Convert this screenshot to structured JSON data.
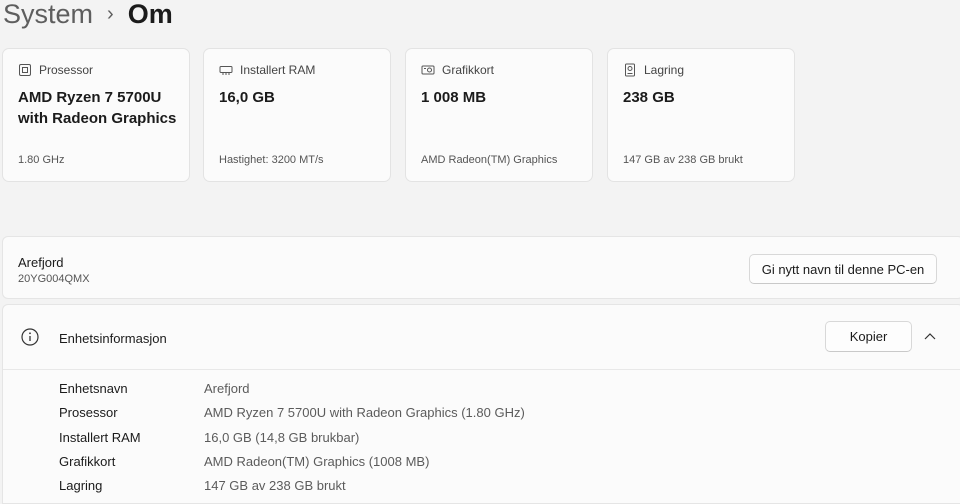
{
  "breadcrumb": {
    "parent": "System",
    "separator": "›",
    "current": "Om"
  },
  "cards": [
    {
      "icon": "processor-icon",
      "label": "Prosessor",
      "value": "AMD Ryzen 7 5700U with Radeon Graphics",
      "sub": "1.80 GHz"
    },
    {
      "icon": "memory-icon",
      "label": "Installert RAM",
      "value": "16,0 GB",
      "sub": "Hastighet: 3200 MT/s"
    },
    {
      "icon": "graphics-card-icon",
      "label": "Grafikkort",
      "value": "1 008 MB",
      "sub": "AMD Radeon(TM) Graphics"
    },
    {
      "icon": "storage-icon",
      "label": "Lagring",
      "value": "238 GB",
      "sub": "147 GB av 238 GB brukt"
    }
  ],
  "device": {
    "name": "Arefjord",
    "model": "20YG004QMX",
    "rename_label": "Gi nytt navn til denne PC-en"
  },
  "info": {
    "title": "Enhetsinformasjon",
    "copy_label": "Kopier",
    "rows": [
      {
        "label": "Enhetsnavn",
        "value": "Arefjord"
      },
      {
        "label": "Prosessor",
        "value": "AMD Ryzen 7 5700U with Radeon Graphics (1.80 GHz)"
      },
      {
        "label": "Installert RAM",
        "value": "16,0 GB (14,8 GB brukbar)"
      },
      {
        "label": "Grafikkort",
        "value": "AMD Radeon(TM) Graphics (1008 MB)"
      },
      {
        "label": "Lagring",
        "value": "147 GB av 238 GB brukt"
      }
    ]
  }
}
